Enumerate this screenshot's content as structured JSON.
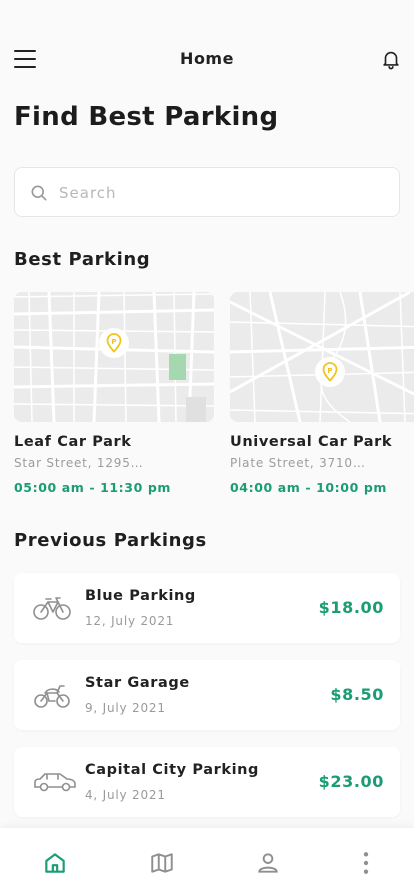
{
  "header": {
    "title": "Home"
  },
  "main": {
    "heading": "Find Best Parking"
  },
  "search": {
    "placeholder": "Search"
  },
  "best_parking": {
    "title": "Best Parking",
    "items": [
      {
        "name": "Leaf Car Park",
        "address": "Star Street, 1295…",
        "hours": "05:00 am - 11:30 pm"
      },
      {
        "name": "Universal Car Park",
        "address": "Plate Street, 3710…",
        "hours": "04:00 am - 10:00 pm"
      }
    ]
  },
  "previous": {
    "title": "Previous Parkings",
    "items": [
      {
        "icon": "bicycle-icon",
        "name": "Blue Parking",
        "date": "12, July 2021",
        "price": "$18.00"
      },
      {
        "icon": "motorcycle-icon",
        "name": "Star Garage",
        "date": "9, July 2021",
        "price": "$8.50"
      },
      {
        "icon": "car-icon",
        "name": "Capital City Parking",
        "date": "4, July 2021",
        "price": "$23.00"
      }
    ]
  },
  "colors": {
    "accent": "#1a9c75",
    "pin": "#f0c419"
  },
  "nav": {
    "items": [
      "home-icon",
      "map-icon",
      "profile-icon",
      "more-icon"
    ]
  }
}
